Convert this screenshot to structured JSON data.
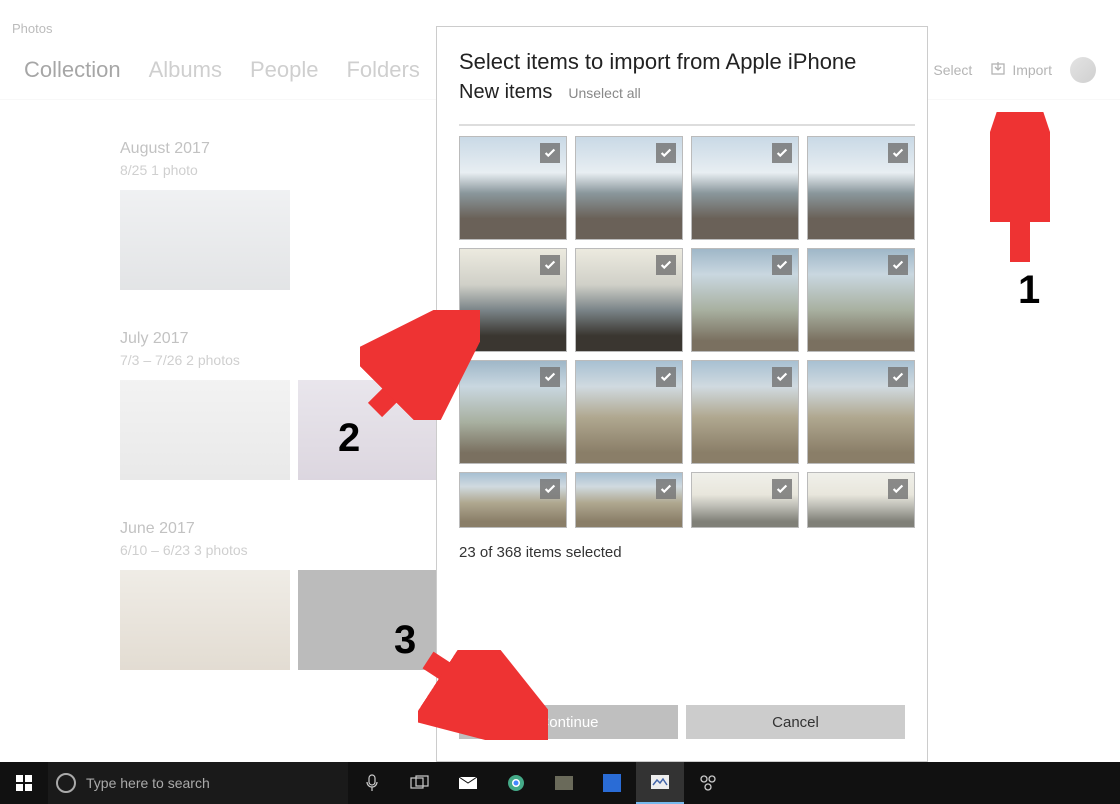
{
  "app_title": "Photos",
  "tabs": [
    "Collection",
    "Albums",
    "People",
    "Folders"
  ],
  "active_tab": 0,
  "header_actions": {
    "select": "Select",
    "import": "Import"
  },
  "collection": [
    {
      "title": "August 2017",
      "sub": "8/25   1 photo",
      "thumbs": 1
    },
    {
      "title": "July 2017",
      "sub": "7/3 – 7/26   2 photos",
      "thumbs": 2
    },
    {
      "title": "June 2017",
      "sub": "6/10 – 6/23   3 photos",
      "thumbs": 2
    }
  ],
  "dialog": {
    "title": "Select items to import from Apple iPhone",
    "subtitle": "New items",
    "unselect": "Unselect all",
    "status": "23 of 368 items selected",
    "continue": "Continue",
    "cancel": "Cancel"
  },
  "taskbar": {
    "search_placeholder": "Type here to search"
  },
  "annotations": {
    "one": "1",
    "two": "2",
    "three": "3"
  }
}
